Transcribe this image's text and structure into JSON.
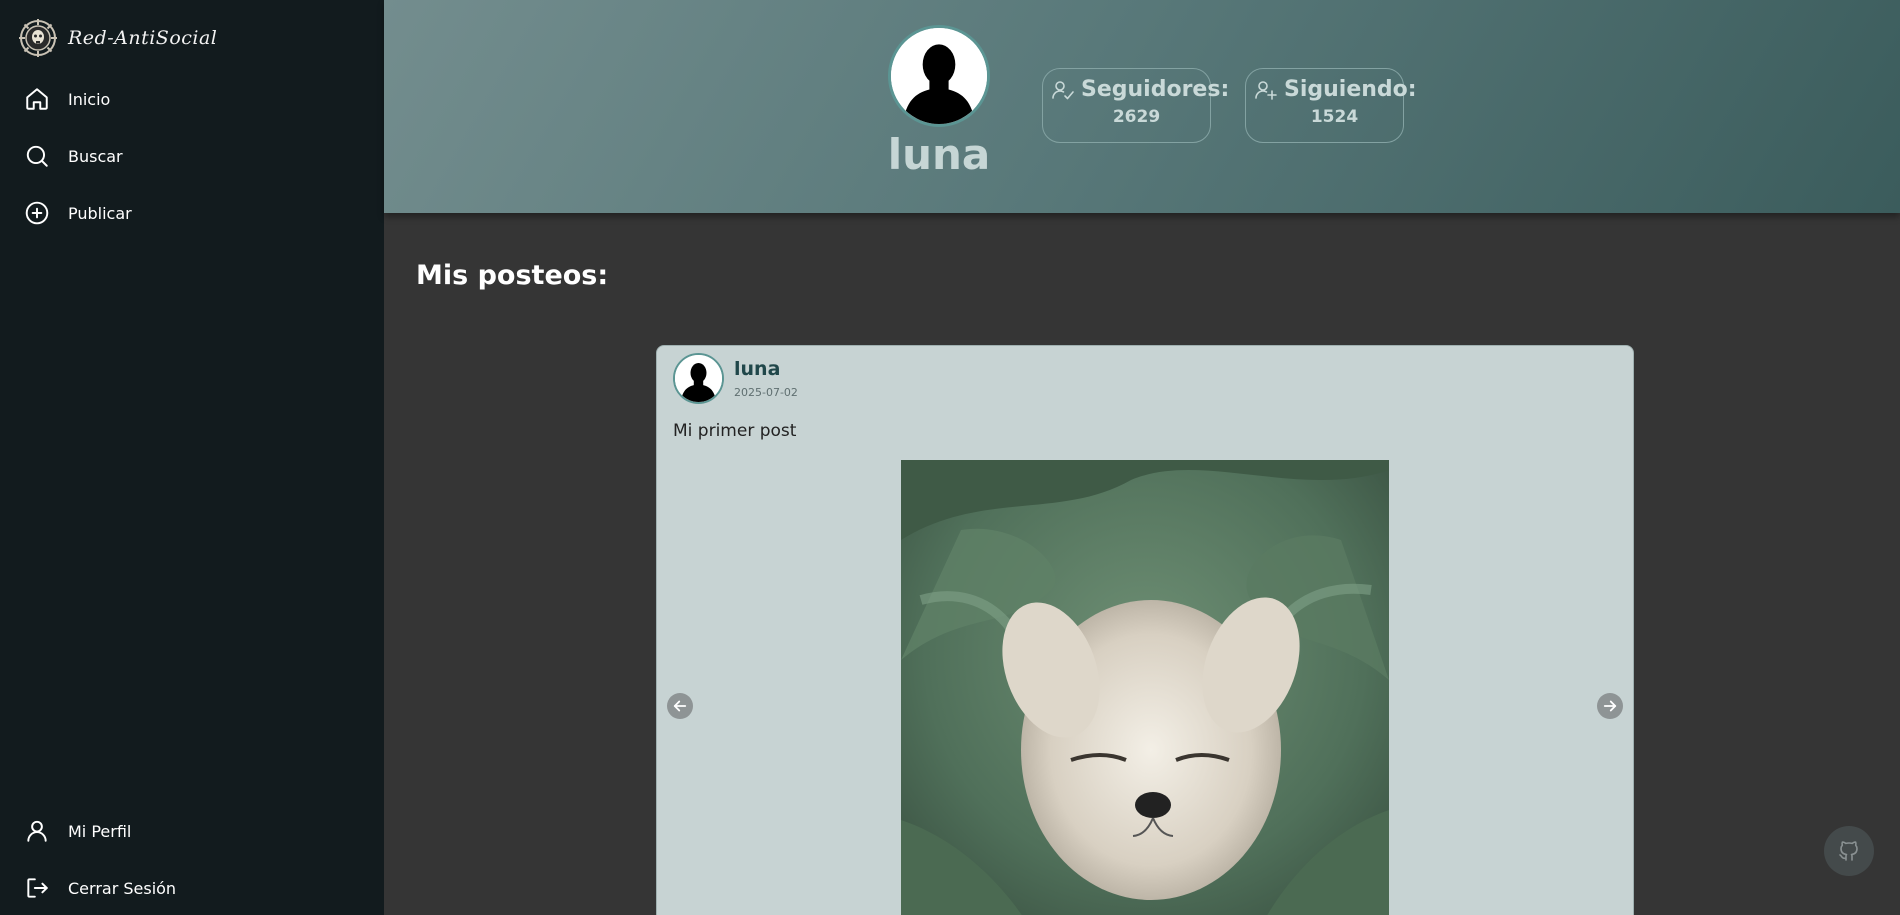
{
  "app": {
    "brand_name": "Red-AntiSocial"
  },
  "sidebar": {
    "items": [
      {
        "label": "Inicio",
        "icon": "home-icon"
      },
      {
        "label": "Buscar",
        "icon": "search-icon"
      },
      {
        "label": "Publicar",
        "icon": "plus-circle-icon"
      }
    ],
    "bottom_items": [
      {
        "label": "Mi Perfil",
        "icon": "user-icon"
      },
      {
        "label": "Cerrar Sesión",
        "icon": "logout-icon"
      }
    ]
  },
  "profile": {
    "username": "luna",
    "followers_label": "Seguidores:",
    "followers_count": "2629",
    "following_label": "Siguiendo:",
    "following_count": "1524"
  },
  "main": {
    "section_title": "Mis posteos:",
    "posts": [
      {
        "author": "luna",
        "date": "2025-07-02",
        "text": "Mi primer post",
        "image_icon": "puppy-photo"
      }
    ]
  },
  "colors": {
    "sidebar_bg": "#121b1e",
    "header_gradient_start": "#738d8e",
    "header_gradient_end": "#3b5c5c",
    "content_bg": "#353535",
    "card_bg": "#c7d3d3",
    "accent": "#5b9593"
  }
}
